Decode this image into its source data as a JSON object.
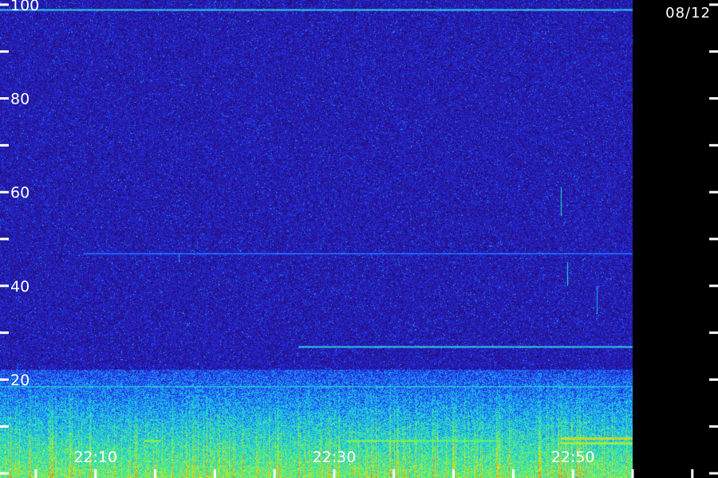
{
  "date_label": "08/12",
  "chart_data": {
    "type": "heatmap",
    "title": "",
    "xlabel": "",
    "ylabel": "",
    "xlim": [
      "22:02",
      "22:55"
    ],
    "ylim": [
      -1,
      101
    ],
    "x_ticks": [
      {
        "time": "22:10",
        "label": "22:10"
      },
      {
        "time": "22:30",
        "label": "22:30"
      },
      {
        "time": "22:50",
        "label": "22:50"
      }
    ],
    "x_minor_step_minutes": 5,
    "y_ticks": [
      {
        "value": 100,
        "label": "100"
      },
      {
        "value": 80,
        "label": "80"
      },
      {
        "value": 60,
        "label": "60"
      },
      {
        "value": 40,
        "label": "40"
      },
      {
        "value": 20,
        "label": "20"
      }
    ],
    "y_minor_step": 10,
    "colorscale": [
      "#1c0c55",
      "#2a10a0",
      "#1e3cf0",
      "#1ea0ff",
      "#1ee6c8",
      "#78f050",
      "#e6e61e",
      "#f0781e",
      "#dc1414"
    ],
    "background_level": 0.15,
    "horizontal_lines": [
      {
        "freq": 99,
        "level": 0.55,
        "from": "22:02",
        "to": "22:55"
      },
      {
        "freq": 47,
        "level": 0.35,
        "from": "22:09",
        "to": "22:55"
      },
      {
        "freq": 27,
        "level": 0.55,
        "from": "22:27",
        "to": "22:55"
      },
      {
        "freq": 18.5,
        "level": 0.5,
        "from": "22:02",
        "to": "22:55"
      }
    ],
    "low_band": {
      "freq_max": 22,
      "level_bottom": 0.6,
      "level_top": 0.25
    },
    "vertical_streaks": [
      {
        "time": "22:49",
        "freq_from": 55,
        "freq_to": 61,
        "level": 0.5
      },
      {
        "time": "22:49.5",
        "freq_from": 40,
        "freq_to": 45,
        "level": 0.5
      },
      {
        "time": "22:52",
        "freq_from": 34,
        "freq_to": 40,
        "level": 0.4
      },
      {
        "time": "22:17",
        "freq_from": 45,
        "freq_to": 47,
        "level": 0.4
      }
    ],
    "bursts": [
      {
        "time_from": "22:14",
        "time_to": "22:15.5",
        "freq": 7,
        "level": 0.68
      },
      {
        "time_from": "22:31",
        "time_to": "22:37",
        "freq": 7,
        "level": 0.66
      },
      {
        "time_from": "22:37",
        "time_to": "22:44",
        "freq": 7,
        "level": 0.62
      },
      {
        "time_from": "22:49",
        "time_to": "22:55",
        "freq": 7.5,
        "level": 0.8
      },
      {
        "time_from": "22:49",
        "time_to": "22:55",
        "freq": 6.5,
        "level": 0.72
      }
    ]
  }
}
